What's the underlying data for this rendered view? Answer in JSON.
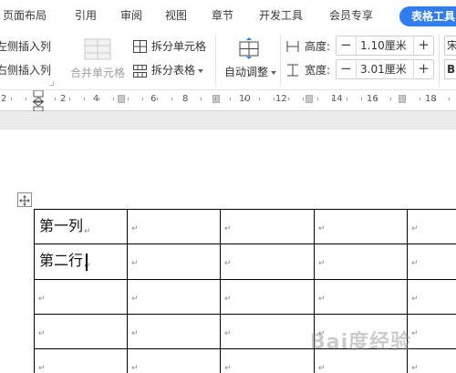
{
  "menu": {
    "tabs": [
      {
        "label": "页面布局",
        "active": false
      },
      {
        "label": "引用",
        "active": false
      },
      {
        "label": "审阅",
        "active": false
      },
      {
        "label": "视图",
        "active": false
      },
      {
        "label": "章节",
        "active": false
      },
      {
        "label": "开发工具",
        "active": false
      },
      {
        "label": "会员专享",
        "active": false
      },
      {
        "label": "表格工具",
        "active": true
      }
    ]
  },
  "ribbon": {
    "insert_left_label": "左侧插入列",
    "insert_right_label": "右侧插入列",
    "merge_cells_label": "合并单元格",
    "split_cells_label": "拆分单元格",
    "split_table_label": "拆分表格",
    "autofit_label": "自动调整",
    "height_label": "高度:",
    "height_value": "1.10厘米",
    "width_label": "宽度:",
    "width_value": "3.01厘米",
    "edge_top_char": "宋",
    "edge_bottom_char": "B"
  },
  "ruler": {
    "numbers": [
      "2",
      "2",
      "4",
      "6",
      "8",
      "10",
      "12",
      "14",
      "16",
      "18",
      "20",
      "22",
      "24"
    ]
  },
  "table": {
    "rows": [
      [
        "第一列",
        "",
        "",
        "",
        ""
      ],
      [
        "第二行",
        "",
        "",
        "",
        ""
      ],
      [
        "",
        "",
        "",
        "",
        ""
      ],
      [
        "",
        "",
        "",
        "",
        ""
      ],
      [
        "",
        "",
        "",
        "",
        ""
      ]
    ],
    "paragraph_mark": "↵"
  },
  "watermark": {
    "text": "Bai度经验"
  },
  "colors": {
    "accent": "#2f7df1",
    "ruler_bg": "#ffffff",
    "page_bg": "#ffffff",
    "workspace_bg": "#ebebeb"
  }
}
